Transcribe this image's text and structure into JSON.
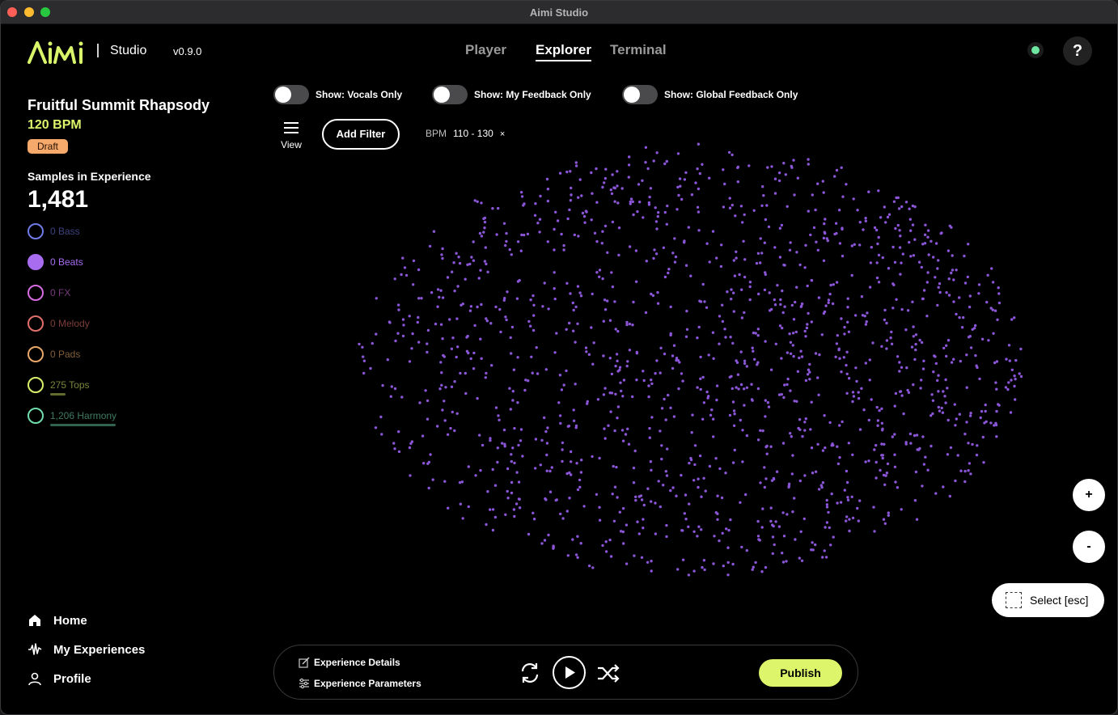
{
  "window": {
    "title": "Aimi Studio"
  },
  "header": {
    "logo_text": "AiMi",
    "app_name": "Studio",
    "version": "v0.9.0",
    "tabs": [
      {
        "label": "Player",
        "active": false
      },
      {
        "label": "Explorer",
        "active": true
      },
      {
        "label": "Terminal",
        "active": false
      }
    ],
    "status_color": "#6ee7a0",
    "help_label": "?"
  },
  "sidebar": {
    "experience_title": "Fruitful Summit Rhapsody",
    "bpm": "120 BPM",
    "status_badge": "Draft",
    "samples_label": "Samples in Experience",
    "samples_count": "1,481",
    "categories": [
      {
        "label": "0 Bass",
        "color": "#6f7be6",
        "filled": false,
        "fraction": 0
      },
      {
        "label": "0 Beats",
        "color": "#a76cf0",
        "filled": true,
        "fraction": 0
      },
      {
        "label": "0 FX",
        "color": "#d76be0",
        "filled": false,
        "fraction": 0
      },
      {
        "label": "0 Melody",
        "color": "#e0706b",
        "filled": false,
        "fraction": 0
      },
      {
        "label": "0 Pads",
        "color": "#e8a86a",
        "filled": false,
        "fraction": 0
      },
      {
        "label": "275 Tops",
        "color": "#d9ef6a",
        "filled": false,
        "fraction": 0.186
      },
      {
        "label": "1,206 Harmony",
        "color": "#6fdcae",
        "filled": false,
        "fraction": 0.814
      }
    ],
    "nav": [
      {
        "label": "Home",
        "icon": "home-icon"
      },
      {
        "label": "My Experiences",
        "icon": "waveform-icon"
      },
      {
        "label": "Profile",
        "icon": "user-icon"
      }
    ]
  },
  "filters": {
    "toggles": [
      {
        "label": "Show: Vocals Only",
        "on": false
      },
      {
        "label": "Show: My Feedback Only",
        "on": false
      },
      {
        "label": "Show: Global Feedback Only",
        "on": false
      }
    ],
    "view_label": "View",
    "add_filter_label": "Add Filter",
    "chip": {
      "key": "BPM",
      "value": "110 - 130",
      "remove": "×"
    }
  },
  "explorer": {
    "point_color": "#8a55d6",
    "zoom_in": "+",
    "zoom_out": "-",
    "select_label": "Select [esc]"
  },
  "player": {
    "details_label": "Experience Details",
    "params_label": "Experience Parameters",
    "publish_label": "Publish",
    "accent": "#dcf56a"
  }
}
